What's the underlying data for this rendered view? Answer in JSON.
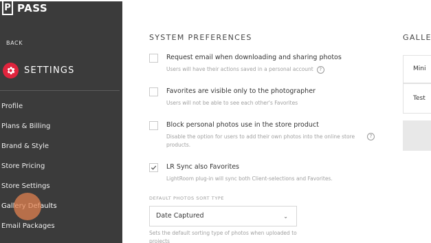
{
  "sidebar": {
    "logo": {
      "letter": "P",
      "text": "PASS"
    },
    "back_label": "BACK",
    "title": "SETTINGS",
    "items": [
      {
        "label": "Profile"
      },
      {
        "label": "Plans & Billing"
      },
      {
        "label": "Brand & Style"
      },
      {
        "label": "Store Pricing"
      },
      {
        "label": "Store Settings"
      },
      {
        "label": "Gallery Defaults"
      },
      {
        "label": "Email Packages"
      }
    ],
    "accent_color": "#e0243d"
  },
  "main": {
    "section_title": "SYSTEM PREFERENCES",
    "options": [
      {
        "label": "Request email when downloading and sharing photos",
        "help": "Users will have their actions saved in a personal account",
        "checked": false
      },
      {
        "label": "Favorites are visible only to the photographer",
        "help": "Users will not be able to see each other's Favorites",
        "checked": false
      },
      {
        "label": "Block personal photos use in the store product",
        "help": "Disable the option for users to add their own photos into the online store products.",
        "checked": false
      },
      {
        "label": "LR Sync also Favorites",
        "help": "LightRoom plug-in will sync both Client-selections and Favorites.",
        "checked": true
      }
    ],
    "sort": {
      "label": "DEFAULT PHOTOS SORT TYPE",
      "value": "Date Captured",
      "help": "Sets the default sorting type of photos when uploaded to projects"
    }
  },
  "right": {
    "title": "GALLE",
    "cards": [
      {
        "label": "Mini"
      },
      {
        "label": "Test"
      }
    ]
  }
}
